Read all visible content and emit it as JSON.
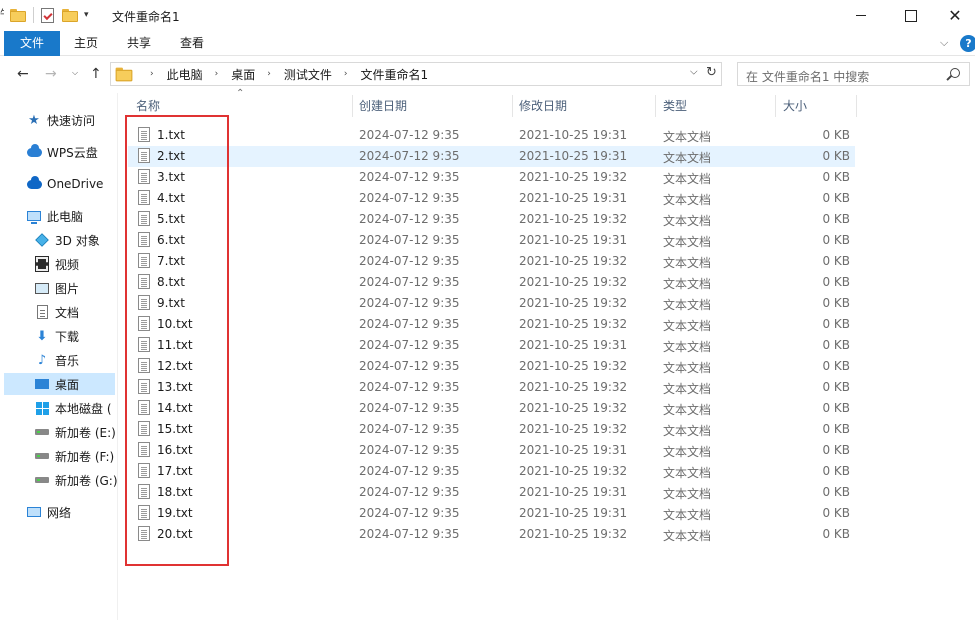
{
  "window": {
    "title": "文件重命名1",
    "close_glyph": "✕"
  },
  "quick_access_toolbar": {
    "clip_char": "牛",
    "dropdown_glyph": "▾",
    "icons": [
      "folder-icon",
      "properties-icon",
      "new-folder-icon"
    ]
  },
  "ribbon": {
    "tabs": [
      "文件",
      "主页",
      "共享",
      "查看"
    ],
    "expand_glyph": "⌵",
    "help_glyph": "?"
  },
  "nav": {
    "back_glyph": "←",
    "forward_glyph": "→",
    "recent_glyph": "⌵",
    "up_glyph": "↑",
    "breadcrumb": [
      "此电脑",
      "桌面",
      "测试文件",
      "文件重命名1"
    ],
    "crumb_chevron": "›",
    "address_dropdown": "⌵",
    "refresh_glyph": "↻",
    "search_placeholder": "在 文件重命名1 中搜索"
  },
  "sidebar": {
    "items": [
      {
        "label": "快速访问",
        "icon": "star-icon"
      },
      {
        "label": "WPS云盘",
        "icon": "cloud-icon"
      },
      {
        "label": "OneDrive",
        "icon": "onedrive-icon"
      },
      {
        "label": "此电脑",
        "icon": "computer-icon"
      },
      {
        "label": "3D 对象",
        "icon": "cube-icon"
      },
      {
        "label": "视频",
        "icon": "video-icon"
      },
      {
        "label": "图片",
        "icon": "picture-icon"
      },
      {
        "label": "文档",
        "icon": "document-icon"
      },
      {
        "label": "下载",
        "icon": "download-icon"
      },
      {
        "label": "音乐",
        "icon": "music-icon"
      },
      {
        "label": "桌面",
        "icon": "desktop-icon",
        "selected": true
      },
      {
        "label": "本地磁盘 (",
        "icon": "system-drive-icon"
      },
      {
        "label": "新加卷 (E:)",
        "icon": "drive-icon"
      },
      {
        "label": "新加卷 (F:)",
        "icon": "drive-icon"
      },
      {
        "label": "新加卷 (G:)",
        "icon": "drive-icon"
      },
      {
        "label": "网络",
        "icon": "network-icon"
      }
    ],
    "star_glyph": "★",
    "download_glyph": "⬇",
    "music_glyph": "♪"
  },
  "file_list": {
    "columns": [
      "名称",
      "创建日期",
      "修改日期",
      "类型",
      "大小"
    ],
    "sort_glyph": "⌃",
    "rows": [
      {
        "name": "1.txt",
        "created": "2024-07-12 9:35",
        "modified": "2021-10-25 19:31",
        "type": "文本文档",
        "size": "0 KB"
      },
      {
        "name": "2.txt",
        "created": "2024-07-12 9:35",
        "modified": "2021-10-25 19:31",
        "type": "文本文档",
        "size": "0 KB",
        "hovered": true
      },
      {
        "name": "3.txt",
        "created": "2024-07-12 9:35",
        "modified": "2021-10-25 19:32",
        "type": "文本文档",
        "size": "0 KB"
      },
      {
        "name": "4.txt",
        "created": "2024-07-12 9:35",
        "modified": "2021-10-25 19:31",
        "type": "文本文档",
        "size": "0 KB"
      },
      {
        "name": "5.txt",
        "created": "2024-07-12 9:35",
        "modified": "2021-10-25 19:32",
        "type": "文本文档",
        "size": "0 KB"
      },
      {
        "name": "6.txt",
        "created": "2024-07-12 9:35",
        "modified": "2021-10-25 19:31",
        "type": "文本文档",
        "size": "0 KB"
      },
      {
        "name": "7.txt",
        "created": "2024-07-12 9:35",
        "modified": "2021-10-25 19:32",
        "type": "文本文档",
        "size": "0 KB"
      },
      {
        "name": "8.txt",
        "created": "2024-07-12 9:35",
        "modified": "2021-10-25 19:32",
        "type": "文本文档",
        "size": "0 KB"
      },
      {
        "name": "9.txt",
        "created": "2024-07-12 9:35",
        "modified": "2021-10-25 19:32",
        "type": "文本文档",
        "size": "0 KB"
      },
      {
        "name": "10.txt",
        "created": "2024-07-12 9:35",
        "modified": "2021-10-25 19:32",
        "type": "文本文档",
        "size": "0 KB"
      },
      {
        "name": "11.txt",
        "created": "2024-07-12 9:35",
        "modified": "2021-10-25 19:31",
        "type": "文本文档",
        "size": "0 KB"
      },
      {
        "name": "12.txt",
        "created": "2024-07-12 9:35",
        "modified": "2021-10-25 19:32",
        "type": "文本文档",
        "size": "0 KB"
      },
      {
        "name": "13.txt",
        "created": "2024-07-12 9:35",
        "modified": "2021-10-25 19:32",
        "type": "文本文档",
        "size": "0 KB"
      },
      {
        "name": "14.txt",
        "created": "2024-07-12 9:35",
        "modified": "2021-10-25 19:32",
        "type": "文本文档",
        "size": "0 KB"
      },
      {
        "name": "15.txt",
        "created": "2024-07-12 9:35",
        "modified": "2021-10-25 19:32",
        "type": "文本文档",
        "size": "0 KB"
      },
      {
        "name": "16.txt",
        "created": "2024-07-12 9:35",
        "modified": "2021-10-25 19:31",
        "type": "文本文档",
        "size": "0 KB"
      },
      {
        "name": "17.txt",
        "created": "2024-07-12 9:35",
        "modified": "2021-10-25 19:32",
        "type": "文本文档",
        "size": "0 KB"
      },
      {
        "name": "18.txt",
        "created": "2024-07-12 9:35",
        "modified": "2021-10-25 19:31",
        "type": "文本文档",
        "size": "0 KB"
      },
      {
        "name": "19.txt",
        "created": "2024-07-12 9:35",
        "modified": "2021-10-25 19:31",
        "type": "文本文档",
        "size": "0 KB"
      },
      {
        "name": "20.txt",
        "created": "2024-07-12 9:35",
        "modified": "2021-10-25 19:32",
        "type": "文本文档",
        "size": "0 KB"
      }
    ]
  },
  "colors": {
    "accent": "#1979ca",
    "selection": "#cce8ff",
    "hover_row": "#e5f3ff",
    "annotation_box": "#e03232",
    "header_text": "#4c607a",
    "secondary_text": "#6d6d6d"
  }
}
